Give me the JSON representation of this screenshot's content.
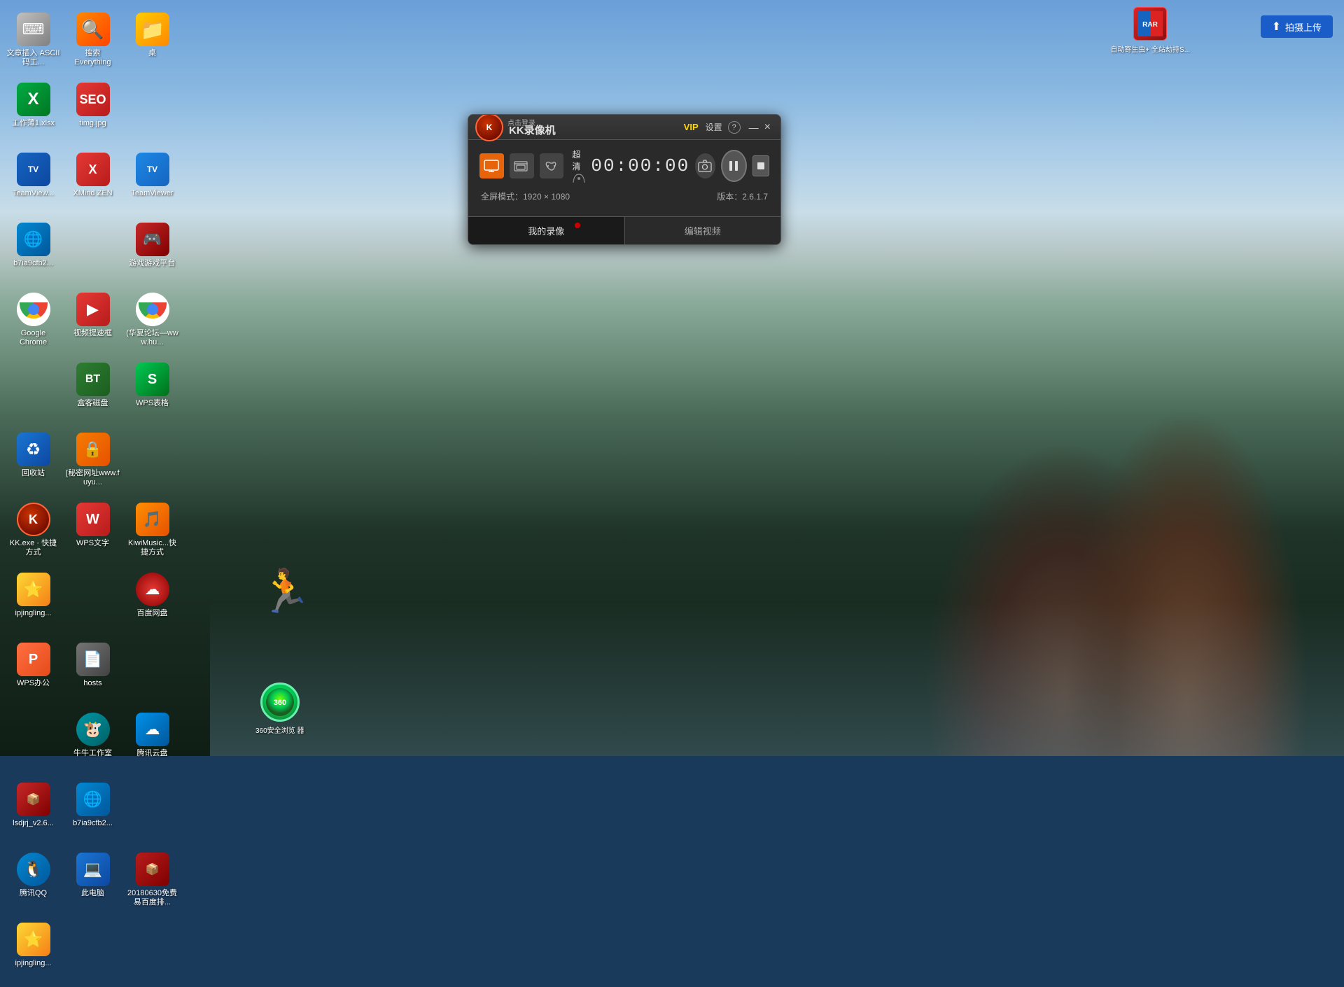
{
  "desktop": {
    "bg_gradient": "ocean-beach",
    "icons": [
      {
        "id": "ascii",
        "label": "文章插入\nASCII码工...",
        "icon_class": "icon-ascii",
        "symbol": "⌨"
      },
      {
        "id": "everything",
        "label": "搜索\nEverything",
        "icon_class": "icon-search",
        "symbol": "🔍"
      },
      {
        "id": "desktop",
        "label": "桌",
        "icon_class": "icon-folder",
        "symbol": "📁"
      },
      {
        "id": "excel",
        "label": "工作薄1.xlsx",
        "icon_class": "icon-excel",
        "symbol": "📊"
      },
      {
        "id": "timg",
        "label": "timg.jpg",
        "icon_class": "icon-seo",
        "symbol": "🖼"
      },
      {
        "id": "empty1",
        "label": "",
        "icon_class": "",
        "symbol": ""
      },
      {
        "id": "teamviewer1",
        "label": "TeamView...",
        "icon_class": "icon-teamviewer-blue",
        "symbol": "TV"
      },
      {
        "id": "xmind",
        "label": "XMind ZEN",
        "icon_class": "icon-xmind",
        "symbol": "X"
      },
      {
        "id": "teamviewer2",
        "label": "TeamViewer",
        "icon_class": "icon-teamviewer",
        "symbol": "TV"
      },
      {
        "id": "b7ia",
        "label": "b7ia9cfb2...",
        "icon_class": "icon-b7ia",
        "symbol": "🌐"
      },
      {
        "id": "empty2",
        "label": "",
        "icon_class": "",
        "symbol": ""
      },
      {
        "id": "game",
        "label": "游戏游戏平台",
        "icon_class": "icon-game",
        "symbol": "🎮"
      },
      {
        "id": "chrome",
        "label": "Google\nChrome",
        "icon_class": "icon-chrome",
        "symbol": "●"
      },
      {
        "id": "video",
        "label": "视频提速框",
        "icon_class": "icon-video",
        "symbol": "▶"
      },
      {
        "id": "chrome2",
        "label": "(华夏论坛—www.hu...",
        "icon_class": "icon-chrome2",
        "symbol": "●"
      },
      {
        "id": "empty3",
        "label": "",
        "icon_class": "",
        "symbol": ""
      },
      {
        "id": "bt",
        "label": "盒客磁盘",
        "icon_class": "icon-bt",
        "symbol": "BT"
      },
      {
        "id": "wps_s",
        "label": "WPS表格",
        "icon_class": "icon-wps-s",
        "symbol": "S"
      },
      {
        "id": "recycle",
        "label": "回收站",
        "icon_class": "icon-recycle",
        "symbol": "♻"
      },
      {
        "id": "baomi",
        "label": "[秘密网址\nwww.fuyu...",
        "icon_class": "icon-baomi",
        "symbol": "🔒"
      },
      {
        "id": "empty4",
        "label": "",
        "icon_class": "",
        "symbol": ""
      },
      {
        "id": "kk",
        "label": "KK.exe · 快\n捷方式",
        "icon_class": "icon-kk",
        "symbol": "K"
      },
      {
        "id": "wps_w",
        "label": "WPS文字",
        "icon_class": "icon-wps-w",
        "symbol": "W"
      },
      {
        "id": "kiwi",
        "label": "KiwiMusic...\n快捷方式",
        "icon_class": "icon-kiwi",
        "symbol": "🎵"
      },
      {
        "id": "ipj",
        "label": "ipjingling...",
        "icon_class": "icon-ipj",
        "symbol": "⭐"
      },
      {
        "id": "empty5",
        "label": "",
        "icon_class": "",
        "symbol": ""
      },
      {
        "id": "baidu",
        "label": "百度网盘",
        "icon_class": "icon-baidu",
        "symbol": "☁"
      },
      {
        "id": "wps_p",
        "label": "WPS办公",
        "icon_class": "icon-wps-p",
        "symbol": "P"
      },
      {
        "id": "hosts",
        "label": "hosts",
        "icon_class": "icon-hosts",
        "symbol": "📄"
      },
      {
        "id": "empty6",
        "label": "",
        "icon_class": "",
        "symbol": ""
      },
      {
        "id": "empty7",
        "label": "",
        "icon_class": "",
        "symbol": ""
      },
      {
        "id": "tj",
        "label": "牛牛工作室",
        "icon_class": "icon-tj",
        "symbol": "🐮"
      },
      {
        "id": "qq_tx",
        "label": "腾讯云盘",
        "icon_class": "icon-tx",
        "symbol": "☁"
      },
      {
        "id": "lsdjrj",
        "label": "lsdjrj_v2.6...",
        "icon_class": "icon-lsdjrj",
        "symbol": "📦"
      },
      {
        "id": "b7ia2",
        "label": "b7ia9cfb2...",
        "icon_class": "icon-b7ia2",
        "symbol": "🌐"
      },
      {
        "id": "empty8",
        "label": "",
        "icon_class": "",
        "symbol": ""
      },
      {
        "id": "qq",
        "label": "腾讯QQ",
        "icon_class": "icon-qq",
        "symbol": "🐧"
      },
      {
        "id": "computer",
        "label": "此电脑",
        "icon_class": "icon-computer",
        "symbol": "💻"
      },
      {
        "id": "zip2018",
        "label": "20180630免\n费易百度排...",
        "icon_class": "icon-zip2018",
        "symbol": "📦"
      },
      {
        "id": "ipj2",
        "label": "ipjingling...",
        "icon_class": "icon-ipj",
        "symbol": "⭐"
      }
    ],
    "top_right": {
      "winrar_label": "自动寄生虫+\n全站劫持S...",
      "upload_label": "拍摄上传"
    }
  },
  "kk_window": {
    "title": "KK录像机",
    "click_login": "点击登录",
    "vip_label": "VIP",
    "settings_label": "设置",
    "help_label": "?",
    "minimize_label": "—",
    "close_label": "×",
    "timer": "00:00:00",
    "quality_label": "超清",
    "fullscreen_mode": "全屏模式：1920 × 1080",
    "version": "版本：2.6.1.7",
    "tab_my_recordings": "我的录像",
    "tab_edit_video": "编辑视频",
    "mode_buttons": [
      "screen",
      "window",
      "gamepad"
    ],
    "pause_btn": "⏸",
    "stop_btn": "■",
    "screenshot_btn": "📷"
  },
  "360_browser": {
    "label": "360安全浏览\n器"
  }
}
